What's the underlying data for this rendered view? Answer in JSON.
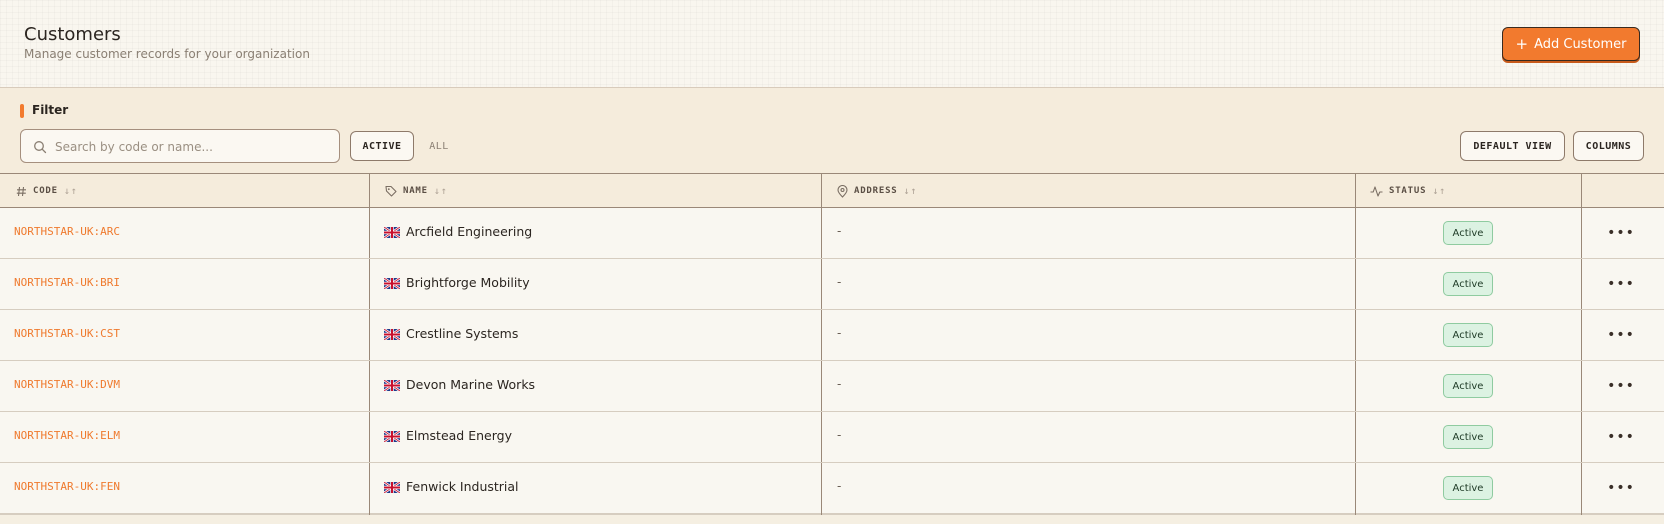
{
  "header": {
    "title": "Customers",
    "subtitle": "Manage customer records for your organization",
    "add_button": {
      "icon": "plus-icon",
      "label": "Add Customer"
    }
  },
  "filter": {
    "label": "Filter",
    "search": {
      "placeholder": "Search by code or name...",
      "value": ""
    },
    "segments": {
      "active": "ACTIVE",
      "all": "ALL",
      "selected": "ACTIVE"
    },
    "buttons": {
      "default_view": "DEFAULT VIEW",
      "columns": "COLUMNS"
    }
  },
  "table": {
    "columns": [
      {
        "icon": "hash-icon",
        "label": "CODE"
      },
      {
        "icon": "tag-icon",
        "label": "NAME"
      },
      {
        "icon": "map-pin-icon",
        "label": "ADDRESS"
      },
      {
        "icon": "activity-icon",
        "label": "STATUS"
      }
    ],
    "rows": [
      {
        "code": "NORTHSTAR-UK:ARC",
        "flag": "uk-flag-icon",
        "name": "Arcfield Engineering",
        "address": "-",
        "status": "Active"
      },
      {
        "code": "NORTHSTAR-UK:BRI",
        "flag": "uk-flag-icon",
        "name": "Brightforge Mobility",
        "address": "-",
        "status": "Active"
      },
      {
        "code": "NORTHSTAR-UK:CST",
        "flag": "uk-flag-icon",
        "name": "Crestline Systems",
        "address": "-",
        "status": "Active"
      },
      {
        "code": "NORTHSTAR-UK:DVM",
        "flag": "uk-flag-icon",
        "name": "Devon Marine Works",
        "address": "-",
        "status": "Active"
      },
      {
        "code": "NORTHSTAR-UK:ELM",
        "flag": "uk-flag-icon",
        "name": "Elmstead Energy",
        "address": "-",
        "status": "Active"
      },
      {
        "code": "NORTHSTAR-UK:FEN",
        "flag": "uk-flag-icon",
        "name": "Fenwick Industrial",
        "address": "-",
        "status": "Active"
      }
    ],
    "row_action_icon": "more-horizontal-icon"
  },
  "colors": {
    "accent": "#f27a2e",
    "code_link": "#ef7a2e",
    "status_bg": "#dcf2e2",
    "status_border": "#8fcba0"
  }
}
